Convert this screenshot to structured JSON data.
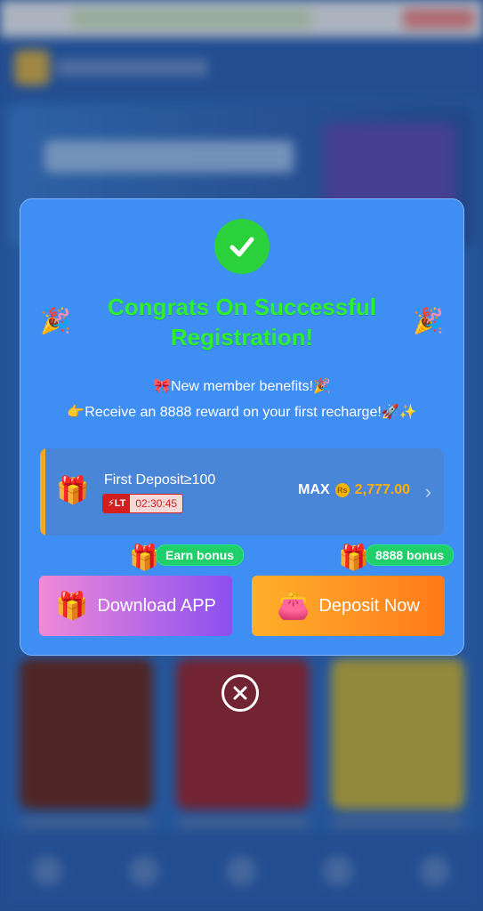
{
  "modal": {
    "title": "Congrats On Successful Registration!",
    "benefits_line1": "🎀New member benefits!🎉",
    "benefits_line2": "👉Receive an 8888 reward on your first recharge!🚀✨",
    "deposit": {
      "label": "First Deposit≥100",
      "badge": "LT",
      "timer": "02:30:45",
      "max_label": "MAX",
      "currency_symbol": "Rs",
      "amount": "2,777.00"
    },
    "earn_bonus_badge": "Earn bonus",
    "deposit_bonus_badge": "8888 bonus",
    "download_button": "Download APP",
    "deposit_button": "Deposit Now"
  },
  "colors": {
    "modal_bg": "#3f8ef4",
    "title_green": "#2bf02b",
    "check_green": "#2bd13a",
    "amount_orange": "#ffb000",
    "bubble_green": "#1fd06a"
  },
  "icons": {
    "success": "check-circle-icon",
    "party": "party-popper-icon",
    "gift": "gift-icon",
    "wallet": "wallet-icon",
    "close": "close-circle-icon",
    "chevron": "chevron-right-icon",
    "lightning": "lightning-icon"
  }
}
